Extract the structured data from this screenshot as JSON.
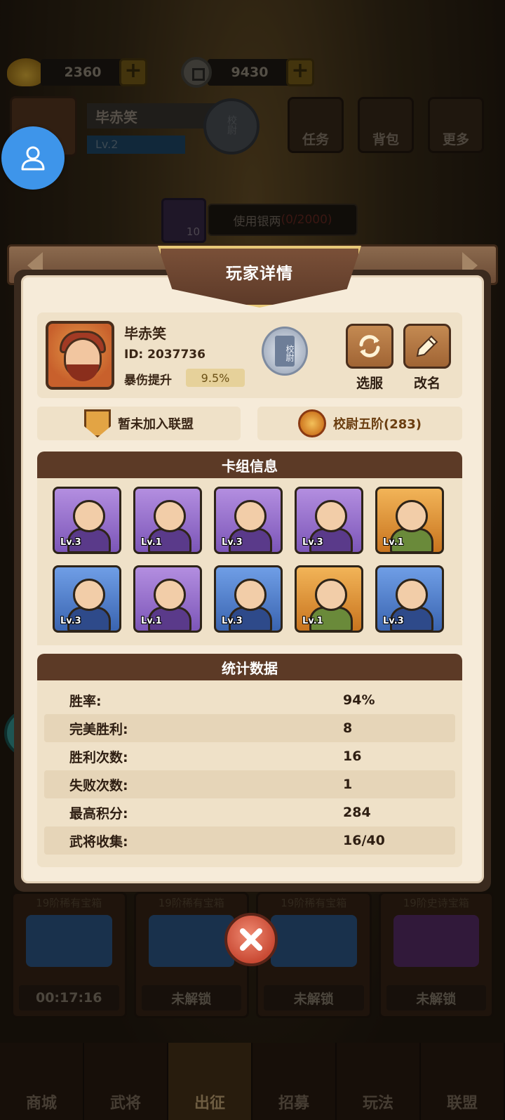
{
  "currency": {
    "ingot_amount": "2360",
    "coin_amount": "9430"
  },
  "background_profile": {
    "name": "毕赤笑",
    "level": "Lv.2",
    "rank_badge": "校尉"
  },
  "top_menu": [
    {
      "label": "任务"
    },
    {
      "label": "背包"
    },
    {
      "label": "更多"
    }
  ],
  "silver": {
    "label": "使用银两",
    "progress": "(0/2000)",
    "box_count": "10"
  },
  "modal": {
    "title": "玩家详情",
    "player": {
      "name": "毕赤笑",
      "id": "ID: 2037736",
      "crit_label": "暴伤提升",
      "crit_value": "9.5%",
      "rank_badge": "校尉"
    },
    "actions": {
      "switch_server": "选服",
      "rename": "改名"
    },
    "alliance": "暂未加入联盟",
    "rank": "校尉五阶(283)",
    "deck": {
      "title": "卡组信息",
      "cards": [
        {
          "level": "Lv.3",
          "rarity": "purple"
        },
        {
          "level": "Lv.1",
          "rarity": "purple"
        },
        {
          "level": "Lv.3",
          "rarity": "purple"
        },
        {
          "level": "Lv.3",
          "rarity": "purple"
        },
        {
          "level": "Lv.1",
          "rarity": "orange"
        },
        {
          "level": "Lv.3",
          "rarity": "blue"
        },
        {
          "level": "Lv.1",
          "rarity": "purple"
        },
        {
          "level": "Lv.3",
          "rarity": "blue"
        },
        {
          "level": "Lv.1",
          "rarity": "orange"
        },
        {
          "level": "Lv.3",
          "rarity": "blue"
        }
      ]
    },
    "stats": {
      "title": "统计数据",
      "rows": [
        {
          "label": "胜率:",
          "value": "94%"
        },
        {
          "label": "完美胜利:",
          "value": "8"
        },
        {
          "label": "胜利次数:",
          "value": "16"
        },
        {
          "label": "失败次数:",
          "value": "1"
        },
        {
          "label": "最高积分:",
          "value": "284"
        },
        {
          "label": "武将收集:",
          "value": "16/40"
        }
      ]
    }
  },
  "chests": [
    {
      "title": "19阶稀有宝箱",
      "status": "00:17:16",
      "color": "#2f5a8a"
    },
    {
      "title": "19阶稀有宝箱",
      "status": "未解锁",
      "color": "#2f5a8a"
    },
    {
      "title": "19阶稀有宝箱",
      "status": "未解锁",
      "color": "#2f5a8a"
    },
    {
      "title": "19阶史诗宝箱",
      "status": "未解锁",
      "color": "#5a2e6a"
    }
  ],
  "bottom_nav": [
    {
      "label": "商城"
    },
    {
      "label": "武将"
    },
    {
      "label": "出征"
    },
    {
      "label": "招募"
    },
    {
      "label": "玩法"
    },
    {
      "label": "联盟"
    }
  ]
}
